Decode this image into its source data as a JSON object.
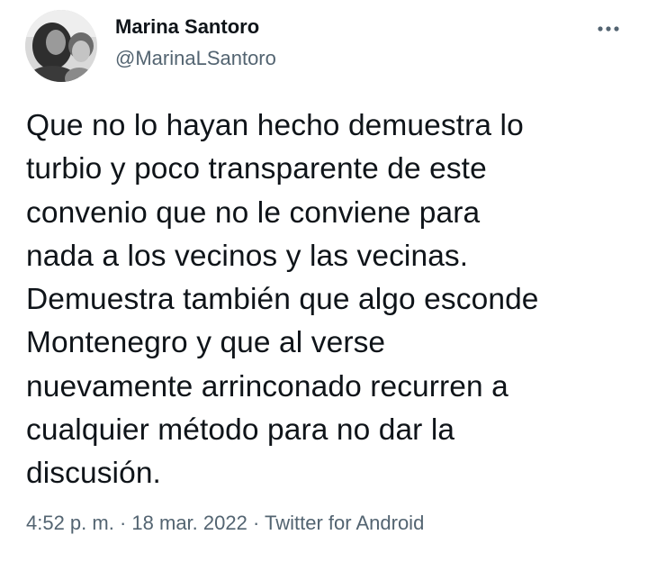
{
  "author": {
    "display_name": "Marina Santoro",
    "handle": "@MarinaLSantoro"
  },
  "menu": {
    "more_icon": "more-horizontal-icon"
  },
  "tweet": {
    "text": "Que no lo hayan hecho demuestra lo\nturbio y poco transparente de este\nconvenio que no le conviene para\nnada a los vecinos y las vecinas.\nDemuestra también que algo esconde\nMontenegro y que al verse\nnuevamente arrinconado recurren a\ncualquier método para no dar la\ndiscusión."
  },
  "meta": {
    "time": "4:52 p. m.",
    "separator": " · ",
    "date": "18 mar. 2022",
    "source": "Twitter for Android"
  },
  "colors": {
    "text_primary": "#0f1419",
    "text_secondary": "#536471",
    "background": "#ffffff"
  }
}
